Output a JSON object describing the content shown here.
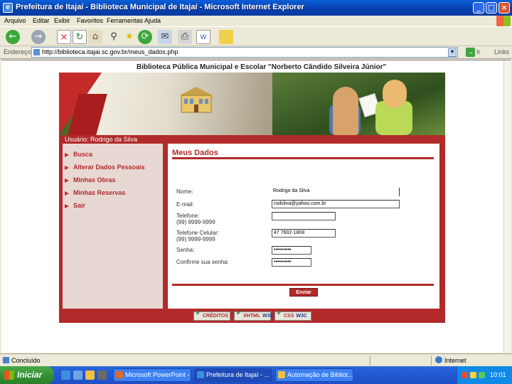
{
  "window": {
    "title": "Prefeitura de Itajaí - Biblioteca Municipal de Itajaí - Microsoft Internet Explorer",
    "buttons": {
      "minimize": "_",
      "maximize": "□",
      "close": "×"
    }
  },
  "menu": [
    "Arquivo",
    "Editar",
    "Exibir",
    "Favoritos",
    "Ferramentas",
    "Ajuda"
  ],
  "toolbar": {
    "icons": [
      "back-icon",
      "forward-icon",
      "stop-icon",
      "refresh-icon",
      "home-icon",
      "search-icon",
      "favorites-icon",
      "history-icon",
      "mail-icon",
      "print-icon",
      "edit-icon",
      "folder-icon"
    ]
  },
  "address": {
    "label": "Endereço",
    "url": "http://biblioteca.itajai.sc.gov.br/meus_dados.php",
    "go": "Ir",
    "links": "Links"
  },
  "page": {
    "site_title": "Biblioteca Pública Municipal e Escolar \"Norberto Cândido Silveira Júnior\"",
    "user_label": "Usuário: Rodrigo da Silva",
    "nav": [
      "Busca",
      "Alterar Dados Pessoais",
      "Minhas Obras",
      "Minhas Reservas",
      "Sair"
    ],
    "heading": "Meus Dados",
    "form": {
      "name_label": "Nome:",
      "name_value": "Rodrigo da Silva",
      "email_label": "E-mail:",
      "email_value": "rodsilva@yahoo.com.br",
      "phone_label": "Telefone:",
      "phone_hint": "(99) 9999-9999",
      "phone_value": "",
      "cell_label": "Telefone Celular:",
      "cell_hint": "(99) 9999-9999",
      "cell_value": "47 7602-1808",
      "password_label": "Senha:",
      "password_value": "••••••••••",
      "confirm_label": "Confirme sua senha:",
      "confirm_value": "••••••••••",
      "submit_label": "Enviar"
    },
    "footer_badges": [
      {
        "label": "CRÉDITOS",
        "mark": ""
      },
      {
        "label": "XHTML",
        "mark": "W3C"
      },
      {
        "label": "CSS",
        "mark": "W3C"
      }
    ]
  },
  "status": {
    "text": "Concluído",
    "zone": "Internet"
  },
  "taskbar": {
    "start": "Iniciar",
    "tasks": [
      "Microsoft PowerPoint - ...",
      "Prefeitura de Itajaí - ...",
      "Automação de Bibliot..."
    ],
    "clock": "10:01"
  }
}
